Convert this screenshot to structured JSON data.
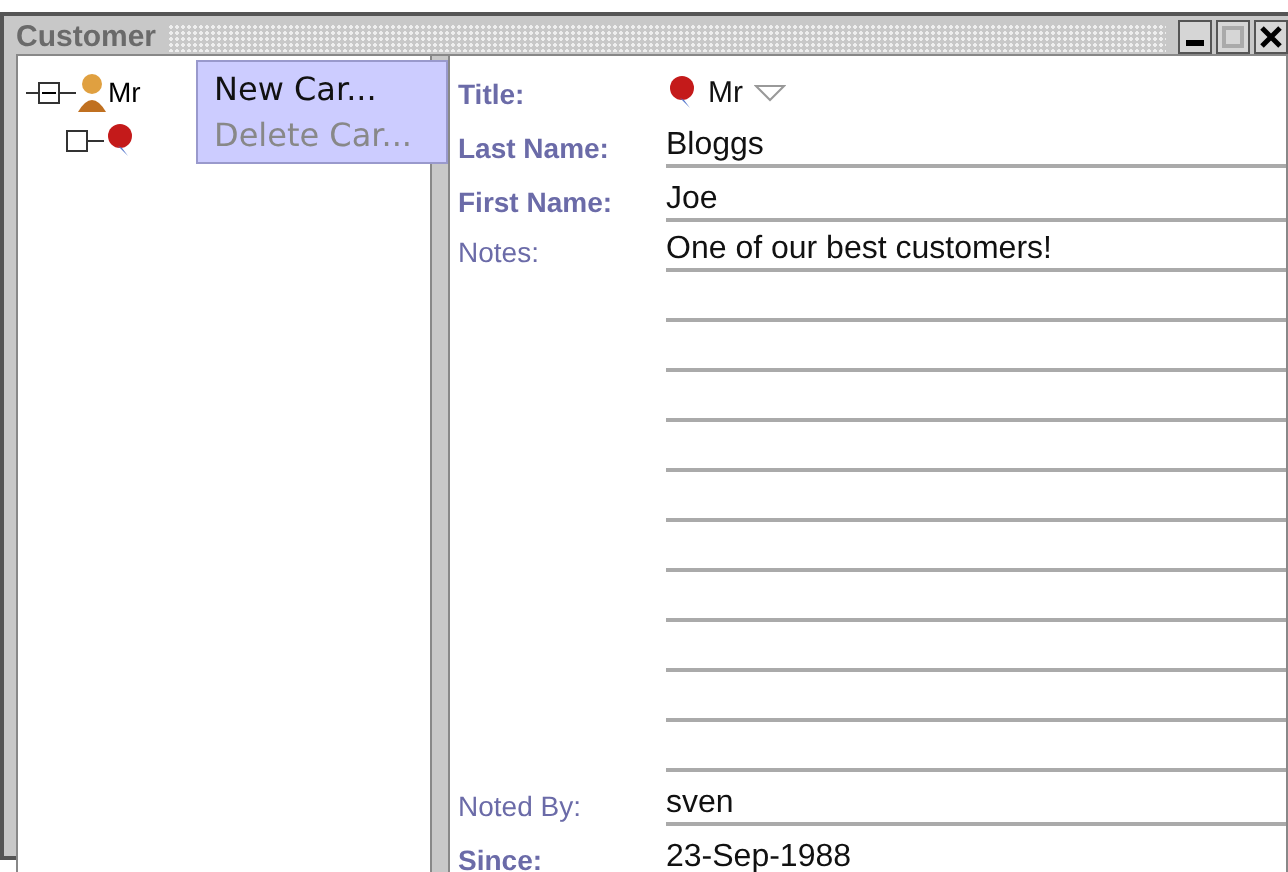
{
  "window": {
    "title": "Customer"
  },
  "tree": [
    {
      "label": "Mr",
      "expanded": true,
      "children": [
        {
          "expanded": false
        }
      ]
    }
  ],
  "context_menu": [
    {
      "label": "New Car...",
      "disabled": false
    },
    {
      "label": "Delete Car...",
      "disabled": true
    }
  ],
  "form": {
    "title": {
      "label": "Title:",
      "bold": true,
      "value": "Mr"
    },
    "last_name": {
      "label": "Last Name:",
      "bold": true,
      "value": "Bloggs"
    },
    "first_name": {
      "label": "First Name:",
      "bold": true,
      "value": "Joe"
    },
    "notes": {
      "label": "Notes:",
      "bold": false,
      "lines": [
        "One of our best customers!"
      ]
    },
    "noted_by": {
      "label": "Noted By:",
      "bold": false,
      "value": "sven"
    },
    "since": {
      "label": "Since:",
      "bold": true,
      "value": "23-Sep-1988"
    }
  }
}
